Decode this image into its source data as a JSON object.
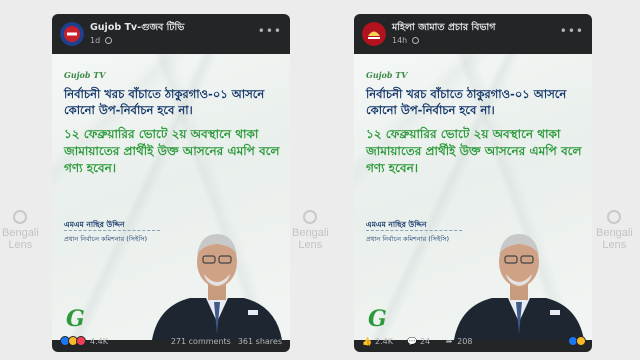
{
  "watermark": {
    "line1": "Bengali",
    "line2": "Lens"
  },
  "posts": [
    {
      "page_name": "Gujob Tv-গুজব টিভি",
      "time": "1d",
      "avatar_color": "#c9202b",
      "graphic": {
        "brand": "Gujob  TV",
        "headline_1": "নির্বাচনী খরচ বাঁচাতে ঠাকুরগাও-০১ আসনে কোনো উপ-নির্বাচন হবে না।",
        "headline_2": "১২ ফেব্রুয়ারির ভোটে ২য় অবস্থানে থাকা জামায়াতের প্রার্থীই উক্ত আসনের এমপি বলে গণ্য হবেন।",
        "speaker_name": "এমএম নাছির উদ্দিন",
        "speaker_title": "প্রধান নির্বাচন কমিশনার (সিইসি)",
        "logo": "G"
      },
      "reactions_count": "4.4K",
      "comments": "271 comments",
      "shares": "361 shares"
    },
    {
      "page_name": "মহিলা জামাত প্রচার বিভাগ",
      "time": "14h",
      "avatar_color": "#b3121f",
      "graphic": {
        "brand": "Gujob  TV",
        "headline_1": "নির্বাচনী খরচ বাঁচাতে ঠাকুরগাও-০১ আসনে কোনো উপ-নির্বাচন হবে না।",
        "headline_2": "১২ ফেব্রুয়ারির ভোটে ২য় অবস্থানে থাকা জামায়াতের প্রার্থীই উক্ত আসনের এমপি বলে গণ্য হবেন।",
        "speaker_name": "এমএম নাছির উদ্দিন",
        "speaker_title": "প্রধান নির্বাচন কমিশনার (সিইসি)",
        "logo": "G"
      },
      "likes": "2.4K",
      "comments": "24",
      "shares": "208"
    }
  ]
}
